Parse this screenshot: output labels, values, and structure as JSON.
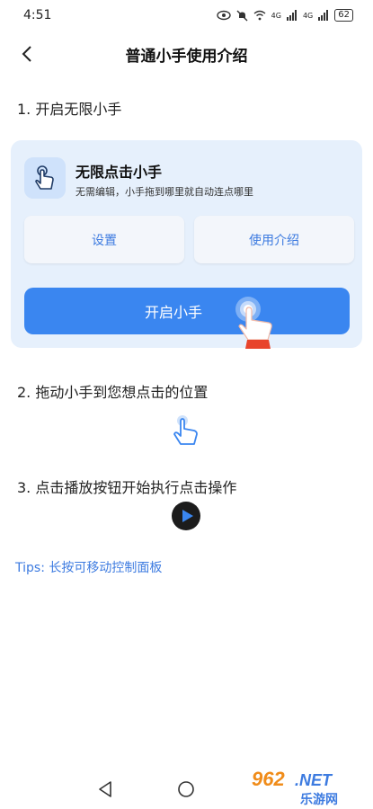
{
  "status_bar": {
    "time": "4:51",
    "signal_1": "4G",
    "signal_2": "4G",
    "battery": "62"
  },
  "header": {
    "title": "普通小手使用介绍"
  },
  "steps": [
    {
      "text": "1. 开启无限小手"
    },
    {
      "text": "2. 拖动小手到您想点击的位置"
    },
    {
      "text": "3. 点击播放按钮开始执行点击操作"
    }
  ],
  "card": {
    "app_name": "无限点击小手",
    "app_desc": "无需编辑，小手拖到哪里就自动连点哪里",
    "settings_label": "设置",
    "intro_label": "使用介绍",
    "start_label": "开启小手"
  },
  "tips": "Tips:  长按可移动控制面板",
  "watermark": {
    "number": "962",
    "suffix": ".NET",
    "text": "乐游网"
  },
  "colors": {
    "accent": "#3a86f0",
    "card_bg": "#e6f0fc",
    "link": "#3d7be0"
  }
}
